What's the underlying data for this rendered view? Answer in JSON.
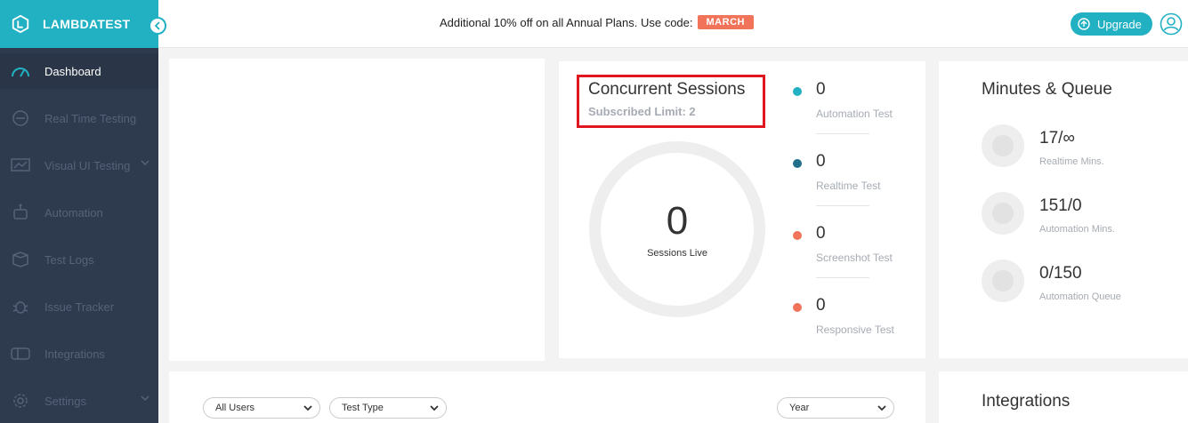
{
  "brand": {
    "name": "LAMBDATEST"
  },
  "sidebar": {
    "items": [
      {
        "label": "Dashboard",
        "icon": "gauge-icon",
        "active": true
      },
      {
        "label": "Real Time Testing",
        "icon": "clock-icon",
        "active": false
      },
      {
        "label": "Visual UI Testing",
        "icon": "monitor-icon",
        "active": false,
        "has_submenu": true
      },
      {
        "label": "Automation",
        "icon": "robot-icon",
        "active": false
      },
      {
        "label": "Test Logs",
        "icon": "box-icon",
        "active": false
      },
      {
        "label": "Issue Tracker",
        "icon": "bug-icon",
        "active": false
      },
      {
        "label": "Integrations",
        "icon": "plug-icon",
        "active": false
      },
      {
        "label": "Settings",
        "icon": "gear-icon",
        "active": false,
        "has_submenu": true
      }
    ]
  },
  "topbar": {
    "promo_text": "Additional 10% off on all Annual Plans. Use code:",
    "promo_code": "MARCH",
    "upgrade_label": "Upgrade"
  },
  "concurrent": {
    "title": "Concurrent Sessions",
    "subtitle": "Subscribed Limit: 2",
    "sessions_live_value": "0",
    "sessions_live_label": "Sessions Live",
    "stats": [
      {
        "value": "0",
        "label": "Automation Test",
        "color": "#21b1c3"
      },
      {
        "value": "0",
        "label": "Realtime Test",
        "color": "#1f6f8b"
      },
      {
        "value": "0",
        "label": "Screenshot Test",
        "color": "#f0735a"
      },
      {
        "value": "0",
        "label": "Responsive Test",
        "color": "#f0735a"
      }
    ]
  },
  "minutes": {
    "title": "Minutes & Queue",
    "items": [
      {
        "value": "17/∞",
        "label": "Realtime Mins."
      },
      {
        "value": "151/0",
        "label": "Automation Mins."
      },
      {
        "value": "0/150",
        "label": "Automation Queue"
      }
    ]
  },
  "filters": {
    "users": "All Users",
    "test_type": "Test Type",
    "period": "Year"
  },
  "integrations": {
    "title": "Integrations"
  },
  "colors": {
    "accent": "#21b1c3",
    "sidebar": "#2e3a4d",
    "promo": "#f0735a",
    "highlight": "#e0171f"
  }
}
